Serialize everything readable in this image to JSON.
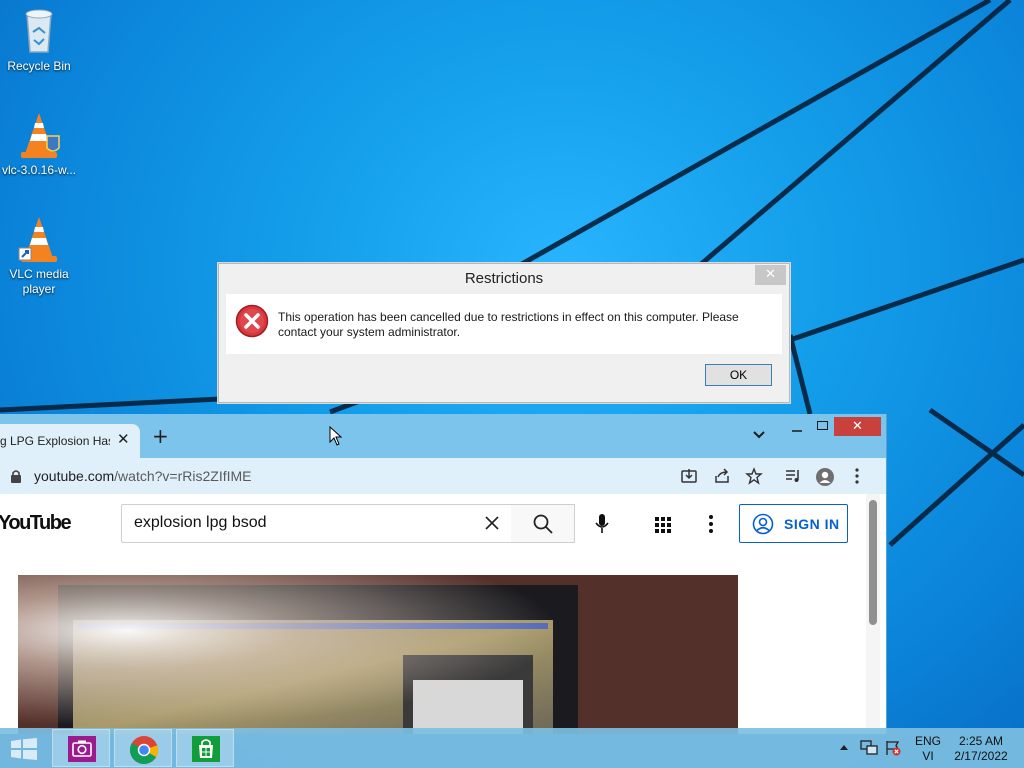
{
  "desktop": {
    "icons": [
      {
        "label": "Recycle Bin"
      },
      {
        "label": "vlc-3.0.16-w..."
      },
      {
        "label": "VLC media player"
      }
    ]
  },
  "dialog": {
    "title": "Restrictions",
    "close_label": "✕",
    "message": "This operation has been cancelled due to restrictions in effect on this computer. Please contact your system administrator.",
    "ok_label": "OK"
  },
  "browser": {
    "tab_title": "g LPG Explosion Has",
    "tab_close": "✕",
    "new_tab": "+",
    "url_host": "youtube.com",
    "url_path": "/watch?v=rRis2ZIfIME",
    "youtube": {
      "logo": "YouTube",
      "search_value": "explosion lpg bsod",
      "signin_label": "SIGN IN"
    },
    "window_close": "✕"
  },
  "taskbar": {
    "language": "ENG",
    "input_method": "VI",
    "time": "2:25 AM",
    "date": "2/17/2022",
    "apps": [
      "camera",
      "chrome",
      "store"
    ]
  }
}
